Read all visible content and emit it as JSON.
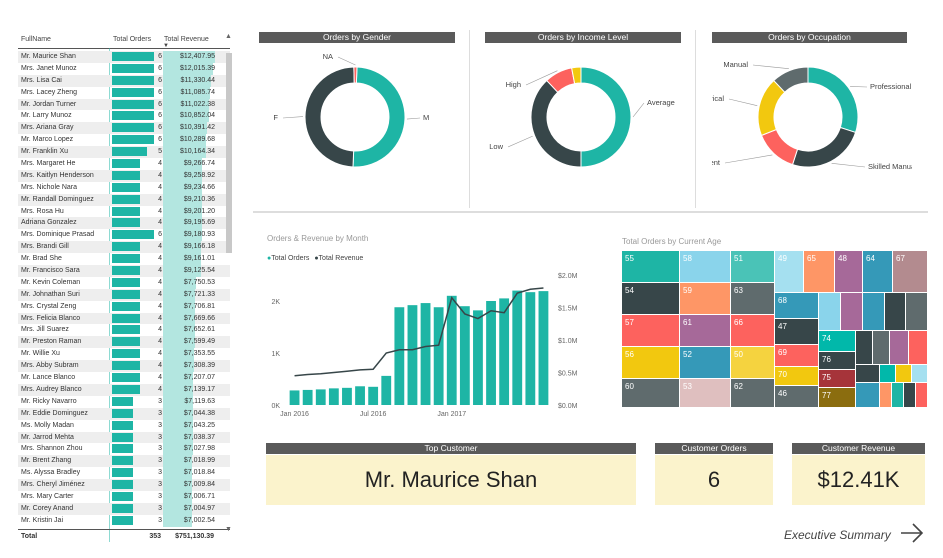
{
  "table": {
    "col_name": "FullName",
    "col_orders": "Total Orders",
    "col_revenue": "Total Revenue",
    "rows": [
      {
        "name": "Mr. Maurice Shan",
        "orders": 6,
        "revenue": "$12,407.95"
      },
      {
        "name": "Mrs. Janet Munoz",
        "orders": 6,
        "revenue": "$12,015.39"
      },
      {
        "name": "Mrs. Lisa Cai",
        "orders": 6,
        "revenue": "$11,330.44"
      },
      {
        "name": "Mrs. Lacey Zheng",
        "orders": 6,
        "revenue": "$11,085.74"
      },
      {
        "name": "Mr. Jordan Turner",
        "orders": 6,
        "revenue": "$11,022.38"
      },
      {
        "name": "Mr. Larry Munoz",
        "orders": 6,
        "revenue": "$10,852.04"
      },
      {
        "name": "Mrs. Ariana Gray",
        "orders": 6,
        "revenue": "$10,391.42"
      },
      {
        "name": "Mr. Marco Lopez",
        "orders": 6,
        "revenue": "$10,289.68"
      },
      {
        "name": "Mr. Franklin Xu",
        "orders": 5,
        "revenue": "$10,164.34"
      },
      {
        "name": "Mrs. Margaret He",
        "orders": 4,
        "revenue": "$9,266.74"
      },
      {
        "name": "Mrs. Kaitlyn Henderson",
        "orders": 4,
        "revenue": "$9,258.92"
      },
      {
        "name": "Mrs. Nichole Nara",
        "orders": 4,
        "revenue": "$9,234.66"
      },
      {
        "name": "Mr. Randall Dominguez",
        "orders": 4,
        "revenue": "$9,210.36"
      },
      {
        "name": "Mrs. Rosa Hu",
        "orders": 4,
        "revenue": "$9,201.20"
      },
      {
        "name": "Adriana Gonzalez",
        "orders": 4,
        "revenue": "$9,195.69"
      },
      {
        "name": "Mrs. Dominique Prasad",
        "orders": 6,
        "revenue": "$9,180.93"
      },
      {
        "name": "Mrs. Brandi Gill",
        "orders": 4,
        "revenue": "$9,166.18"
      },
      {
        "name": "Mr. Brad She",
        "orders": 4,
        "revenue": "$9,161.01"
      },
      {
        "name": "Mr. Francisco Sara",
        "orders": 4,
        "revenue": "$9,125.54"
      },
      {
        "name": "Mr. Kevin Coleman",
        "orders": 4,
        "revenue": "$7,750.53"
      },
      {
        "name": "Mr. Johnathan Suri",
        "orders": 4,
        "revenue": "$7,721.33"
      },
      {
        "name": "Mrs. Crystal Zeng",
        "orders": 4,
        "revenue": "$7,706.81"
      },
      {
        "name": "Mrs. Felicia Blanco",
        "orders": 4,
        "revenue": "$7,669.66"
      },
      {
        "name": "Mrs. Jill Suarez",
        "orders": 4,
        "revenue": "$7,652.61"
      },
      {
        "name": "Mr. Preston Raman",
        "orders": 4,
        "revenue": "$7,599.49"
      },
      {
        "name": "Mr. Willie Xu",
        "orders": 4,
        "revenue": "$7,353.55"
      },
      {
        "name": "Mrs. Abby Subram",
        "orders": 4,
        "revenue": "$7,308.39"
      },
      {
        "name": "Mr. Lance Blanco",
        "orders": 4,
        "revenue": "$7,207.07"
      },
      {
        "name": "Mrs. Audrey Blanco",
        "orders": 4,
        "revenue": "$7,139.17"
      },
      {
        "name": "Mr. Ricky Navarro",
        "orders": 3,
        "revenue": "$7,119.63"
      },
      {
        "name": "Mr. Eddie Dominguez",
        "orders": 3,
        "revenue": "$7,044.38"
      },
      {
        "name": "Ms. Molly Madan",
        "orders": 3,
        "revenue": "$7,043.25"
      },
      {
        "name": "Mr. Jarrod Mehta",
        "orders": 3,
        "revenue": "$7,038.37"
      },
      {
        "name": "Mrs. Shannon Zhou",
        "orders": 3,
        "revenue": "$7,027.98"
      },
      {
        "name": "Mr. Brent Zhang",
        "orders": 3,
        "revenue": "$7,018.99"
      },
      {
        "name": "Ms. Alyssa Bradley",
        "orders": 3,
        "revenue": "$7,018.84"
      },
      {
        "name": "Mrs. Cheryl Jiménez",
        "orders": 3,
        "revenue": "$7,009.84"
      },
      {
        "name": "Mrs. Mary Carter",
        "orders": 3,
        "revenue": "$7,006.71"
      },
      {
        "name": "Mr. Corey Anand",
        "orders": 3,
        "revenue": "$7,004.97"
      },
      {
        "name": "Mr. Kristin Jai",
        "orders": 3,
        "revenue": "$7,002.54"
      }
    ],
    "total_label": "Total",
    "total_orders": "353",
    "total_revenue": "$751,130.39",
    "max_orders": 6,
    "max_revenue": 12407.95
  },
  "donuts": [
    {
      "title": "Orders by Gender",
      "slices": [
        {
          "label": "M",
          "value": 50,
          "color": "#1eb5a5"
        },
        {
          "label": "F",
          "value": 49,
          "color": "#374649"
        },
        {
          "label": "NA",
          "value": 1,
          "color": "#fd625e"
        }
      ]
    },
    {
      "title": "Orders by Income Level",
      "slices": [
        {
          "label": "Average",
          "value": 50,
          "color": "#1eb5a5"
        },
        {
          "label": "Low",
          "value": 38,
          "color": "#374649"
        },
        {
          "label": "High",
          "value": 9,
          "color": "#fd625e"
        },
        {
          "label": "",
          "value": 3,
          "color": "#f2c80f"
        }
      ]
    },
    {
      "title": "Orders by Occupation",
      "slices": [
        {
          "label": "Professional",
          "value": 30,
          "color": "#1eb5a5"
        },
        {
          "label": "Skilled Manual",
          "value": 25,
          "color": "#374649"
        },
        {
          "label": "Management",
          "value": 14,
          "color": "#fd625e"
        },
        {
          "label": "Clerical",
          "value": 19,
          "color": "#f2c80f"
        },
        {
          "label": "Manual",
          "value": 12,
          "color": "#5f6b6d"
        }
      ]
    }
  ],
  "chart_data": {
    "type": "bar",
    "title": "Orders & Revenue by Month",
    "legend": [
      "Total Orders",
      "Total Revenue"
    ],
    "colors": {
      "orders": "#1eb5a5",
      "revenue": "#374649"
    },
    "x_ticks": [
      "Jan 2016",
      "Jul 2016",
      "Jan 2017"
    ],
    "y_ticks": [
      "0K",
      "1K",
      "2K"
    ],
    "y2_ticks": [
      "$0.0M",
      "$0.5M",
      "$1.0M",
      "$1.5M",
      "$2.0M"
    ],
    "ylim": [
      0,
      2500
    ],
    "y2lim": [
      0,
      2.0
    ],
    "orders": [
      280,
      290,
      300,
      320,
      330,
      360,
      350,
      560,
      1880,
      1920,
      1960,
      1880,
      2100,
      1900,
      1820,
      2000,
      2050,
      2200,
      2170,
      2190
    ],
    "revenue": [
      0.45,
      0.47,
      0.48,
      0.5,
      0.52,
      0.54,
      0.55,
      0.8,
      0.85,
      0.85,
      0.9,
      0.92,
      1.65,
      1.4,
      1.33,
      1.45,
      1.42,
      1.72,
      1.78,
      1.8
    ]
  },
  "treemap": {
    "title": "Total Orders by Current Age",
    "cells": [
      {
        "label": "55",
        "color": "#1eb5a5"
      },
      {
        "label": "58",
        "color": "#8ad4eb"
      },
      {
        "label": "51",
        "color": "#4ac3b7"
      },
      {
        "label": "49",
        "color": "#a5e0f0"
      },
      {
        "label": "65",
        "color": "#fe9666"
      },
      {
        "label": "48",
        "color": "#a66999"
      },
      {
        "label": "64",
        "color": "#3599b8"
      },
      {
        "label": "67",
        "color": "#b38b8f"
      },
      {
        "label": "54",
        "color": "#374649"
      },
      {
        "label": "59",
        "color": "#fe9666"
      },
      {
        "label": "63",
        "color": "#5f6b6d"
      },
      {
        "label": "68",
        "color": "#3599b8"
      },
      {
        "label": "57",
        "color": "#fd625e"
      },
      {
        "label": "61",
        "color": "#a66999"
      },
      {
        "label": "66",
        "color": "#fd625e"
      },
      {
        "label": "47",
        "color": "#374649"
      },
      {
        "label": "74",
        "color": "#01b8aa"
      },
      {
        "label": "56",
        "color": "#f2c80f"
      },
      {
        "label": "52",
        "color": "#3599b8"
      },
      {
        "label": "50",
        "color": "#f5d33f"
      },
      {
        "label": "69",
        "color": "#fd625e"
      },
      {
        "label": "76",
        "color": "#374649"
      },
      {
        "label": "60",
        "color": "#5f6b6d"
      },
      {
        "label": "53",
        "color": "#dfbfbf"
      },
      {
        "label": "62",
        "color": "#5f6b6d"
      },
      {
        "label": "70",
        "color": "#f2c80f"
      },
      {
        "label": "75",
        "color": "#a6343a"
      },
      {
        "label": "46",
        "color": "#5f6b6d"
      },
      {
        "label": "77",
        "color": "#8b6d0f"
      }
    ]
  },
  "cards": {
    "top_customer_title": "Top Customer",
    "top_customer_value": "Mr. Maurice Shan",
    "orders_title": "Customer Orders",
    "orders_value": "6",
    "revenue_title": "Customer Revenue",
    "revenue_value": "$12.41K"
  },
  "nav": {
    "label": "Executive Summary"
  }
}
